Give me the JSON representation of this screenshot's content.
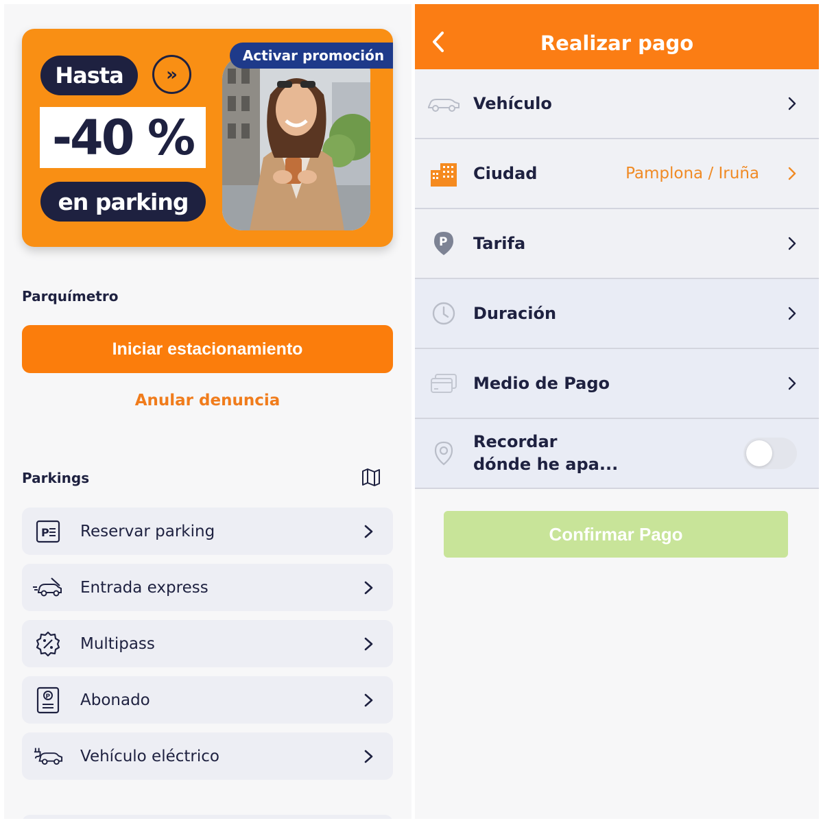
{
  "promo": {
    "hasta": "Hasta",
    "discount": "-40 %",
    "parking": "en parking",
    "activar": "Activar promoción",
    "arrow_glyph": "»",
    "bg_color": "#f98f14",
    "navy_color": "#1e2140",
    "badge_color": "#1e3a8a"
  },
  "parquimetro": {
    "title": "Parquímetro",
    "start_button": "Iniciar estacionamiento",
    "cancel_link": "Anular denuncia"
  },
  "parkings": {
    "title": "Parkings",
    "map_icon": "map-icon",
    "items": [
      {
        "label": "Reservar parking",
        "icon": "parking-ticket-icon"
      },
      {
        "label": "Entrada express",
        "icon": "express-car-icon"
      },
      {
        "label": "Multipass",
        "icon": "discount-badge-icon"
      },
      {
        "label": "Abonado",
        "icon": "parking-pass-icon"
      },
      {
        "label": "Vehículo eléctrico",
        "icon": "electric-car-icon"
      }
    ]
  },
  "payment": {
    "title": "Realizar pago",
    "back_icon": "back-arrow-icon",
    "rows": [
      {
        "label": "Vehículo",
        "value": "",
        "icon": "car-icon"
      },
      {
        "label": "Ciudad",
        "value": "Pamplona / Iruña",
        "icon": "city-buildings-icon"
      },
      {
        "label": "Tarifa",
        "value": "",
        "icon": "parking-pin-icon"
      },
      {
        "label": "Duración",
        "value": "",
        "icon": "clock-icon"
      },
      {
        "label": "Medio de Pago",
        "value": "",
        "icon": "credit-card-icon"
      }
    ],
    "remember": {
      "line1": "Recordar",
      "line2": "dónde he apa...",
      "toggle_on": false,
      "icon": "location-pin-icon"
    },
    "confirm_button": "Confirmar Pago",
    "accent_color": "#fb7d14",
    "confirm_color": "#c8e499"
  }
}
